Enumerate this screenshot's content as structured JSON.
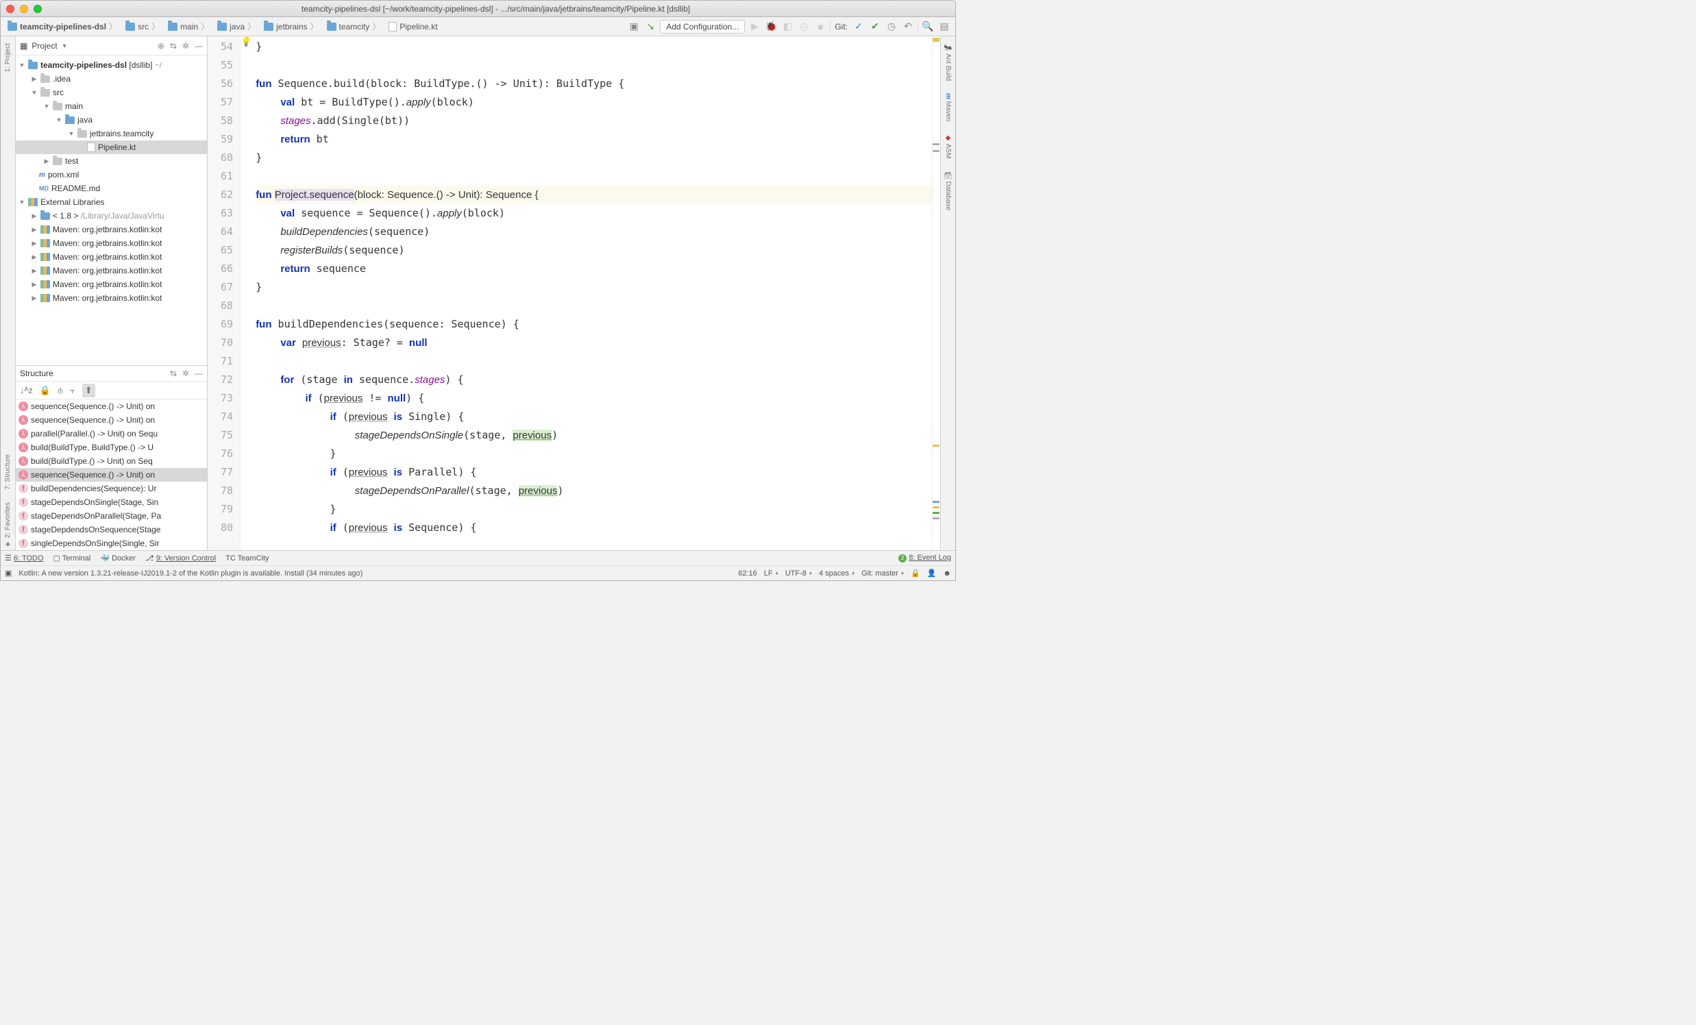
{
  "title": "teamcity-pipelines-dsl [~/work/teamcity-pipelines-dsl] - .../src/main/java/jetbrains/teamcity/Pipeline.kt [dsllib]",
  "breadcrumbs": [
    "teamcity-pipelines-dsl",
    "src",
    "main",
    "java",
    "jetbrains",
    "teamcity",
    "Pipeline.kt"
  ],
  "toolbar": {
    "add_config": "Add Configuration...",
    "git": "Git:"
  },
  "left_tabs": {
    "project": "1: Project"
  },
  "left_tabs2": {
    "structure": "7: Structure",
    "favorites": "2: Favorites"
  },
  "right_tabs": {
    "ant": "Ant Build",
    "maven": "Maven",
    "asm": "ASM",
    "database": "Database"
  },
  "project_panel": {
    "title": "Project",
    "root": {
      "name": "teamcity-pipelines-dsl",
      "tag": "[dsllib]",
      "path": "~/"
    },
    "tree": {
      "idea": ".idea",
      "src": "src",
      "main": "main",
      "java": "java",
      "pkg": "jetbrains.teamcity",
      "file": "Pipeline.kt",
      "test": "test",
      "pom": "pom.xml",
      "readme": "README.md",
      "extlib": "External Libraries",
      "lib0": "< 1.8 >",
      "lib0path": "/Library/Java/JavaVirtu",
      "lib1": "Maven: org.jetbrains.kotlin:kot",
      "lib2": "Maven: org.jetbrains.kotlin:kot",
      "lib3": "Maven: org.jetbrains.kotlin:kot",
      "lib4": "Maven: org.jetbrains.kotlin:kot",
      "lib5": "Maven: org.jetbrains.kotlin:kot",
      "lib6": "Maven: org.jetbrains.kotlin:kot"
    }
  },
  "structure_panel": {
    "title": "Structure",
    "items": [
      "sequence(Sequence.() -> Unit) on",
      "sequence(Sequence.() -> Unit) on",
      "parallel(Parallel.() -> Unit) on Sequ",
      "build(BuildType, BuildType.() -> U",
      "build(BuildType.() -> Unit) on Seq",
      "sequence(Sequence.() -> Unit) on",
      "buildDependencies(Sequence): Ur",
      "stageDependsOnSingle(Stage, Sin",
      "stageDependsOnParallel(Stage, Pa",
      "stageDepdendsOnSequence(Stage",
      "singleDependsOnSingle(Single, Sir"
    ]
  },
  "editor": {
    "lines_start": 54,
    "lines_end": 80
  },
  "bottom": {
    "todo": "6: TODO",
    "terminal": "Terminal",
    "docker": "Docker",
    "vcs": "9: Version Control",
    "teamcity": "TeamCity",
    "eventlog": "8: Event Log"
  },
  "status": {
    "message": "Kotlin: A new version 1.3.21-release-IJ2019.1-2 of the Kotlin plugin is available. Install (34 minutes ago)",
    "pos": "62:16",
    "le": "LF",
    "enc": "UTF-8",
    "indent": "4 spaces",
    "git": "Git: master"
  }
}
